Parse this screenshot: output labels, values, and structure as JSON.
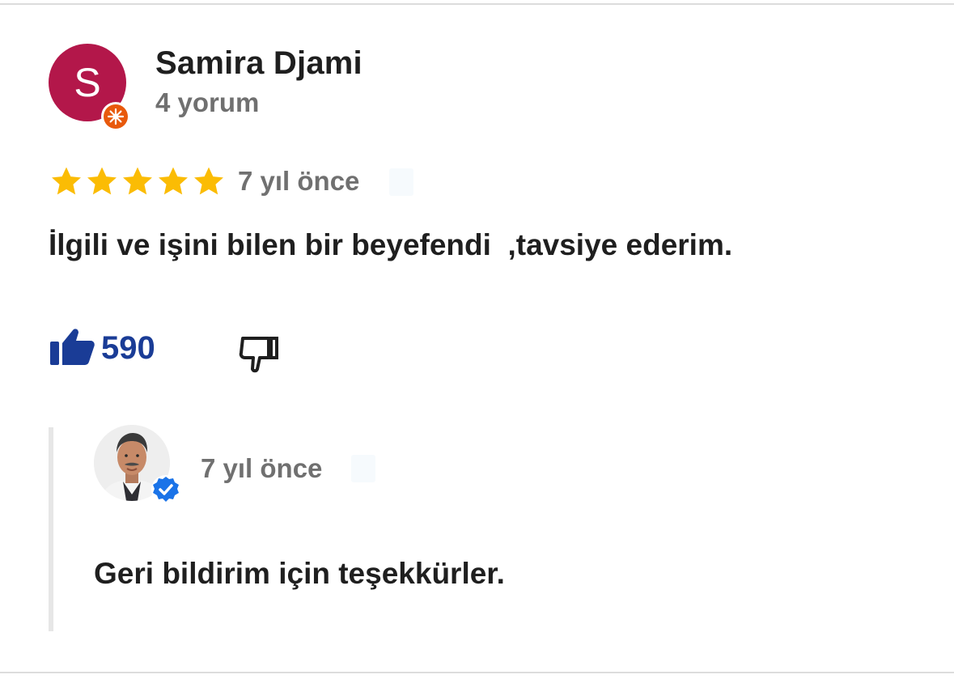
{
  "review": {
    "reviewer_name": "Samira Djami",
    "reviewer_initial": "S",
    "review_count": "4 yorum",
    "avatar_color": "#b3174a",
    "guide_badge_color": "#e8590c",
    "rating": 5,
    "rating_max": 5,
    "star_color": "#fbbc04",
    "time_ago": "7 yıl önce",
    "text": "İlgili ve işini bilen bir beyefendi  ,tavsiye ederim.",
    "like_count": "590",
    "like_color": "#1a3c96",
    "icons": {
      "guide_badge": "local-guide-badge-icon",
      "like": "thumbs-up-filled-icon",
      "dislike": "thumbs-down-outline-icon"
    }
  },
  "owner_response": {
    "time_ago": "7 yıl önce",
    "text": "Geri bildirim için teşekkürler.",
    "verified_color": "#1a73e8",
    "icons": {
      "avatar": "owner-photo-avatar",
      "verified": "verified-badge-icon"
    }
  }
}
